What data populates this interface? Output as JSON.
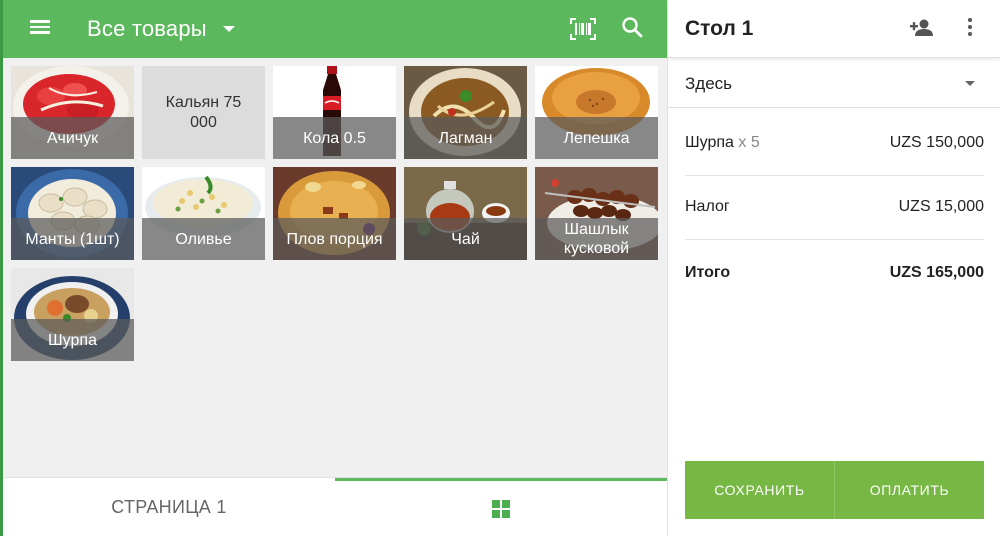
{
  "header": {
    "category_title": "Все товары"
  },
  "products": [
    {
      "name": "Ачичук",
      "image": "achichuk-photo"
    },
    {
      "name": "Кальян 75 000",
      "image": ""
    },
    {
      "name": "Кола 0.5",
      "image": "cola-photo"
    },
    {
      "name": "Лагман",
      "image": "lagman-photo"
    },
    {
      "name": "Лепешка",
      "image": "lepeshka-photo"
    },
    {
      "name": "Манты (1шт)",
      "image": "manty-photo"
    },
    {
      "name": "Оливье",
      "image": "olivier-photo"
    },
    {
      "name": "Плов порция",
      "image": "plov-photo"
    },
    {
      "name": "Чай",
      "image": "tea-photo"
    },
    {
      "name": "Шашлык кусковой",
      "image": "shashlik-photo"
    },
    {
      "name": "Шурпа",
      "image": "shurpa-photo"
    }
  ],
  "bottom_tabs": {
    "page_label": "СТРАНИЦА 1"
  },
  "order": {
    "title": "Стол 1",
    "dining_option": "Здесь",
    "items": [
      {
        "name": "Шурпа",
        "qty": "x 5",
        "amount": "UZS 150,000"
      }
    ],
    "tax_label": "Налог",
    "tax_amount": "UZS 15,000",
    "total_label": "Итого",
    "total_amount": "UZS 165,000",
    "save_label": "СОХРАНИТЬ",
    "pay_label": "ОПЛАТИТЬ"
  },
  "colors": {
    "toolbar_green": "#5cb85c",
    "button_green": "#76b843",
    "tile_label_bg": "#5a5a5a"
  }
}
